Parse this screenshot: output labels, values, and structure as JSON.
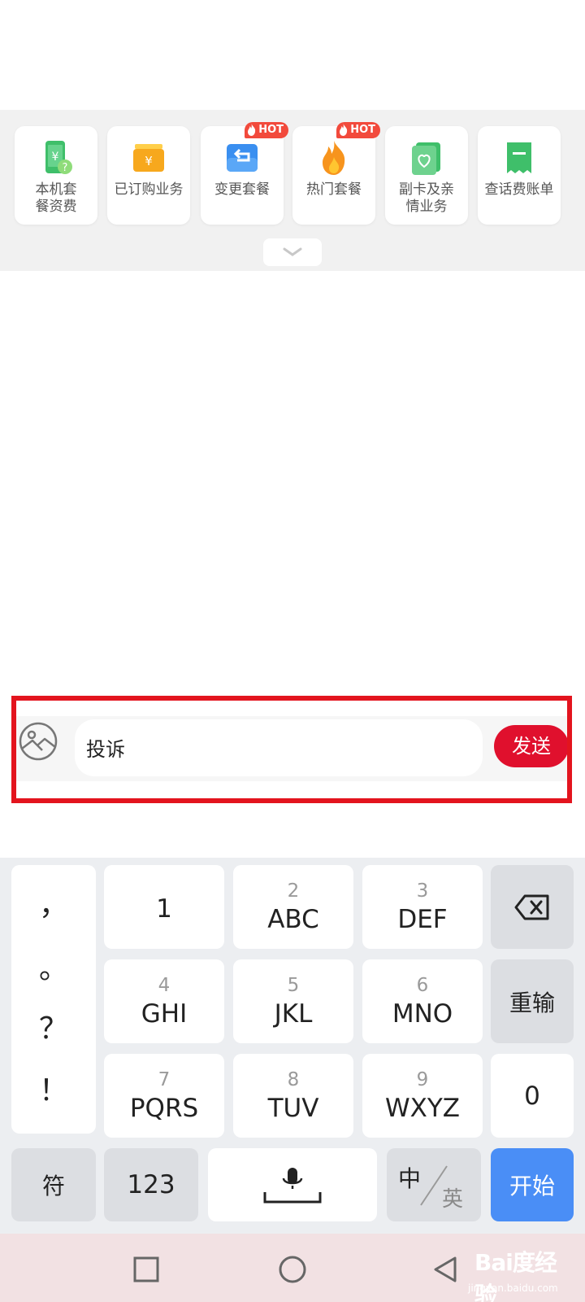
{
  "services": [
    {
      "label": "本机套\n餐资费",
      "icon": "phone-plan-icon",
      "hot": false
    },
    {
      "label": "已订购业务",
      "icon": "subscribed-wallet-icon",
      "hot": false
    },
    {
      "label": "变更套餐",
      "icon": "change-plan-icon",
      "hot": true
    },
    {
      "label": "热门套餐",
      "icon": "fire-icon",
      "hot": true
    },
    {
      "label": "副卡及亲\n情业务",
      "icon": "family-card-icon",
      "hot": false
    },
    {
      "label": "查话费账单",
      "icon": "bill-icon",
      "hot": false
    }
  ],
  "hot_badge": "HOT",
  "input": {
    "value": "投诉"
  },
  "send_label": "发送",
  "keyboard": {
    "punctuation": [
      "，",
      "。",
      "？",
      "！"
    ],
    "rows": [
      [
        {
          "num": "",
          "letters": "1"
        },
        {
          "num": "2",
          "letters": "ABC"
        },
        {
          "num": "3",
          "letters": "DEF"
        }
      ],
      [
        {
          "num": "4",
          "letters": "GHI"
        },
        {
          "num": "5",
          "letters": "JKL"
        },
        {
          "num": "6",
          "letters": "MNO"
        }
      ],
      [
        {
          "num": "7",
          "letters": "PQRS"
        },
        {
          "num": "8",
          "letters": "TUV"
        },
        {
          "num": "9",
          "letters": "WXYZ"
        }
      ]
    ],
    "reinput_label": "重输",
    "zero_label": "0",
    "symbol_label": "符",
    "numeric_label": "123",
    "lang_zh": "中",
    "lang_en": "英",
    "start_label": "开始"
  },
  "watermark": {
    "main": "Bai度经验",
    "sub": "jingyan.baidu.com"
  },
  "colors": {
    "accent_red": "#e0102d",
    "keyboard_blue": "#4a8ef6",
    "hot_orange": "#f24a3c"
  }
}
